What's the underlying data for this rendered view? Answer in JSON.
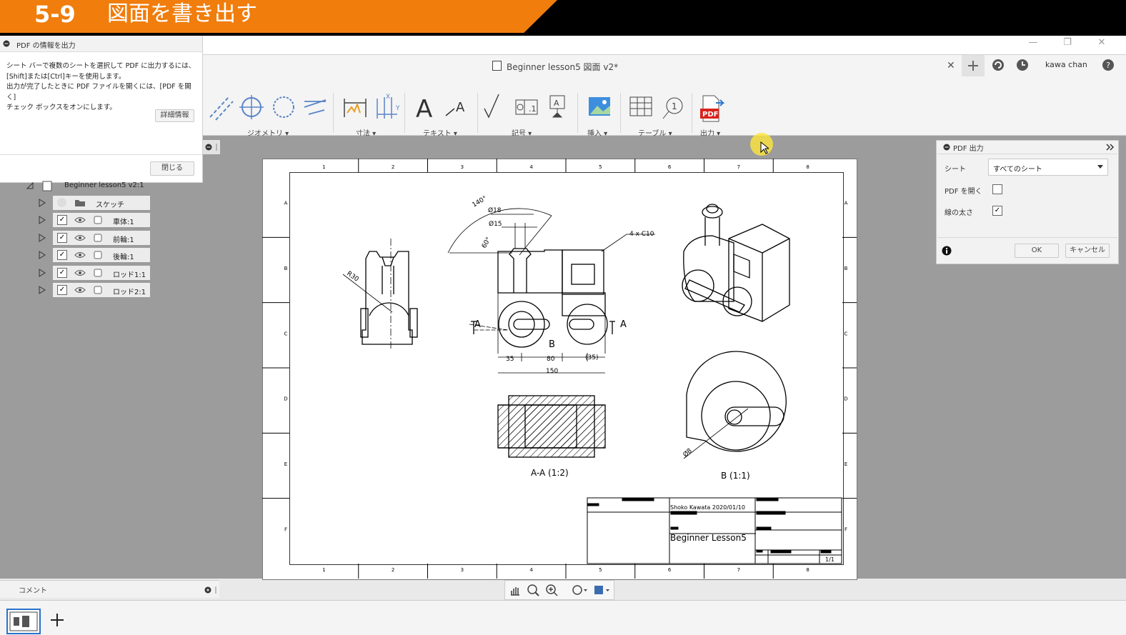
{
  "banner": {
    "number": "5-9",
    "title": "図面を書き出す"
  },
  "window": {
    "minimize": "—",
    "restore": "❐",
    "close": "✕"
  },
  "document": {
    "title": "Beginner lesson5 図面 v2*",
    "close": "✕"
  },
  "account": {
    "user": "kawa chan"
  },
  "toolbar": {
    "groups": [
      {
        "label": "ジオメトリ ▾"
      },
      {
        "label": "寸法 ▾"
      },
      {
        "label": "テキスト ▾"
      },
      {
        "label": "記号 ▾"
      },
      {
        "label": "挿入 ▾"
      },
      {
        "label": "テーブル ▾"
      },
      {
        "label": "出力 ▾"
      }
    ]
  },
  "info_dialog": {
    "title": "PDF の情報を出力",
    "lines": [
      "シート バーで複数のシートを選択して PDF に出力するには、",
      "[Shift]または[Ctrl]キーを使用します。",
      "出力が完了したときに PDF ファイルを開くには、[PDF を開く]",
      "チェック ボックスをオンにします。"
    ],
    "details_button": "詳細情報",
    "close_button": "閉じる"
  },
  "browser": {
    "root": "Beginner lesson5 v2:1",
    "items": [
      {
        "label": "スケッチ",
        "checked": false
      },
      {
        "label": "車体:1",
        "checked": true
      },
      {
        "label": "前輪:1",
        "checked": true
      },
      {
        "label": "後輪:1",
        "checked": true
      },
      {
        "label": "ロッド1:1",
        "checked": true
      },
      {
        "label": "ロッド2:1",
        "checked": true
      }
    ]
  },
  "pdf_panel": {
    "title": "PDF 出力",
    "sheet_label": "シート",
    "sheet_value": "すべてのシート",
    "open_pdf_label": "PDF を開く",
    "open_pdf_checked": false,
    "line_weight_label": "線の太さ",
    "line_weight_checked": true,
    "ok": "OK",
    "cancel": "キャンセル"
  },
  "drawing": {
    "cols": [
      "1",
      "2",
      "3",
      "4",
      "5",
      "6",
      "7",
      "8"
    ],
    "rows": [
      "A",
      "B",
      "C",
      "D",
      "E",
      "F"
    ],
    "dims": {
      "angle": "140°",
      "d18": "Ø18",
      "d15": "Ø15",
      "a60": "60°",
      "chamfer": "4 x C10",
      "r30": "R30",
      "w35": "35",
      "w80": "80",
      "w35b": "(35)",
      "w150": "150",
      "d8": "Ø8",
      "A": "A",
      "B": "B"
    },
    "section_label": "A-A (1:2)",
    "detail_label": "B (1:1)",
    "title_block": {
      "author": "Shoko Kawata  2020/01/10",
      "title": "Beginner Lesson5",
      "sheet": "1/1"
    }
  },
  "comment": {
    "label": "コメント"
  }
}
